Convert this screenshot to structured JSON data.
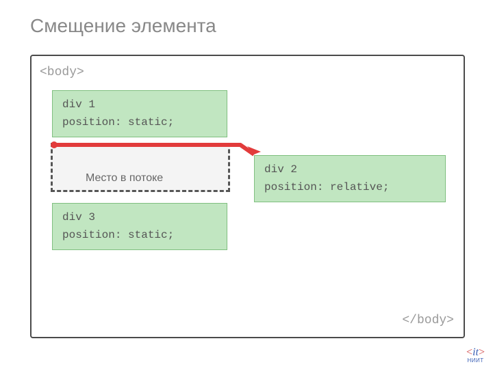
{
  "title": "Смещение элемента",
  "body_tag_open": "<body>",
  "body_tag_close": "</body>",
  "box1": {
    "name": "div 1",
    "css": "position: static;"
  },
  "box2": {
    "name": "div 2",
    "css": "position: relative;"
  },
  "box3": {
    "name": "div 3",
    "css": "position: static;"
  },
  "placeholder_label": "Место в потоке",
  "logo": {
    "brand": "it",
    "org": "НИИТ"
  },
  "colors": {
    "box_bg": "#c1e6c1",
    "box_border": "#7fbf7f",
    "arrow": "#e23b3b",
    "title": "#888888"
  }
}
